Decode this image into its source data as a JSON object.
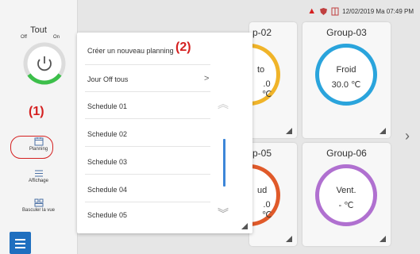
{
  "status": {
    "warning_icon": "warning-triangle-icon",
    "datetime": "12/02/2019 Ma 07:49 PM"
  },
  "sidebar": {
    "tout": "Tout",
    "off": "Off",
    "on": "On",
    "annotation": "(1)",
    "nav": [
      {
        "icon": "calendar-icon",
        "label": "Planning"
      },
      {
        "icon": "list-icon",
        "label": "Affichage"
      },
      {
        "icon": "switch-view-icon",
        "label": "Basculer la vue"
      }
    ]
  },
  "popup": {
    "annotation": "(2)",
    "items": [
      "Créer un nouveau planning",
      "Jour Off tous",
      "Schedule 01",
      "Schedule 02",
      "Schedule 03",
      "Schedule 04",
      "Schedule 05"
    ],
    "chevron": ">"
  },
  "groups": [
    {
      "name": "p-02",
      "mode": "to",
      "temp": ".0 ℃",
      "ring_color": "#f0b429"
    },
    {
      "name": "Group-03",
      "mode": "Froid",
      "temp": "30.0 ℃",
      "ring_color": "#2aa4dc"
    },
    {
      "name": "p-05",
      "mode": "ud",
      "temp": ".0 ℃",
      "ring_color": "#e05a2a"
    },
    {
      "name": "Group-06",
      "mode": "Vent.",
      "temp": "- ℃",
      "ring_color": "#b070d0"
    }
  ],
  "colors": {
    "accent": "#1f6fbf",
    "highlight": "#d52020",
    "power_green": "#3cbf4a"
  }
}
